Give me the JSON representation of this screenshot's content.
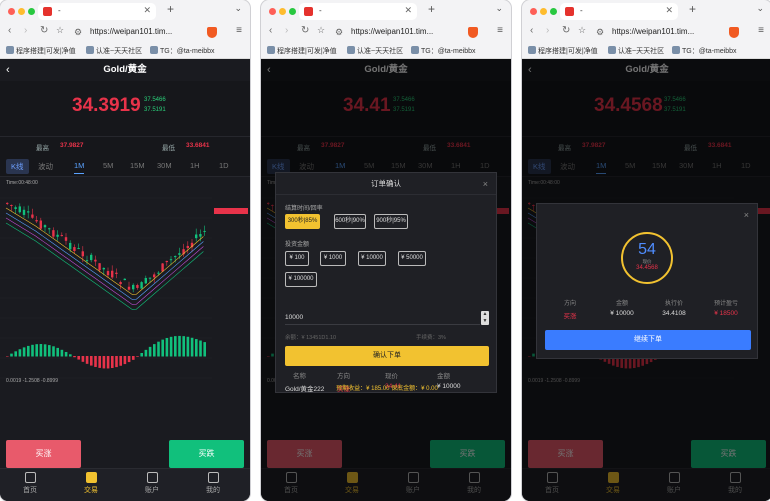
{
  "browser": {
    "tab_title": "-",
    "url": "https://weipan101.tim...",
    "bookmarks": [
      "程序搭建|可发|净值",
      "认准~天天社区",
      "TG：@ta-meibbx"
    ]
  },
  "app": {
    "title": "Gold/黄金",
    "tabs": [
      {
        "label": "首页"
      },
      {
        "label": "交易"
      },
      {
        "label": "账户"
      },
      {
        "label": "我的"
      }
    ],
    "periods": [
      "K线",
      "波动",
      "1M",
      "5M",
      "15M",
      "30M",
      "1H",
      "1D"
    ],
    "high_label": "最高",
    "low_label": "最低",
    "buy_up": "买涨",
    "buy_down": "买跌",
    "chart_legend": "Time:00:48:00",
    "indicator_legend": "0.0019 -1.2508 -0.8999"
  },
  "win1": {
    "price": "34.3919",
    "bid": "37.5466",
    "ask": "37.5191",
    "high": "37.9827",
    "low": "33.6841"
  },
  "win2": {
    "price": "34.41",
    "bid": "37.5466",
    "ask": "37.5191",
    "high": "37.9827",
    "low": "33.6841"
  },
  "win3": {
    "price": "34.4568",
    "bid": "37.5466",
    "ask": "37.5191",
    "high": "37.9827",
    "low": "33.6841"
  },
  "order_modal": {
    "title": "订单确认",
    "close": "×",
    "time_label": "结算时间/回率",
    "time_options": [
      "300秒|85%",
      "600秒|90%",
      "900秒|95%"
    ],
    "amount_label": "投资金额",
    "amount_options": [
      "¥ 100",
      "¥ 1000",
      "¥ 10000",
      "¥ 50000",
      "¥ 100000"
    ],
    "amount_value": "10000",
    "balance_text": "余额：¥ 13451D1.10",
    "fee_text": "手续费：3%",
    "confirm": "确认下单",
    "headers": [
      "名称",
      "方向",
      "现价",
      "金额"
    ],
    "row": [
      "Gold/黄金222",
      "买涨",
      "34.41",
      "¥ 10000"
    ],
    "footer": "预期收益：¥ 185.00   保底金额：¥ 0.00"
  },
  "result_modal": {
    "close": "×",
    "countdown": "54",
    "countdown_label": "现价",
    "price": "34.4568",
    "headers": [
      "方向",
      "金额",
      "执行价",
      "预计盈亏"
    ],
    "values": [
      "买涨",
      "¥ 10000",
      "34.4108",
      "¥ 18500"
    ],
    "continue": "继续下单"
  },
  "colors": {
    "up": "#e8334a",
    "down": "#11c07c",
    "accent": "#f2c230",
    "blue": "#4f8dff"
  }
}
